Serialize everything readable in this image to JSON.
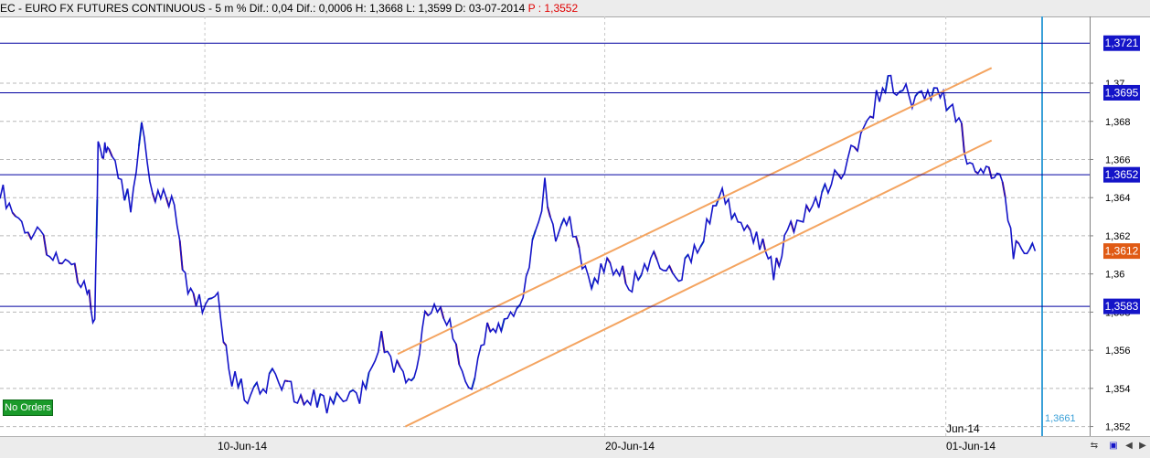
{
  "header": {
    "instrument": "EC - EURO FX FUTURES CONTINUOUS",
    "interval": "5 m",
    "dif_pct": "% Dif.: 0,04",
    "dif": "Dif.: 0,0006",
    "high": "H: 1,3668",
    "low": "L: 1,3599",
    "date": "D: 03-07-2014",
    "price": "P : 1,3552"
  },
  "badge": {
    "label": "No Orders",
    "color": "#1a9a2a"
  },
  "colors": {
    "price_line": "#1414c8",
    "up_tick": "#00a0a0",
    "down_tick": "#d01010",
    "channel": "#f4a460",
    "level": "#0000a0",
    "cursor": "#3aa0d8",
    "current_badge": "#e05a14"
  },
  "chart_data": {
    "type": "line",
    "ylim": [
      1.3515,
      1.3735
    ],
    "y_ticks": [
      "1,352",
      "1,354",
      "1,356",
      "1,358",
      "1,36",
      "1,362",
      "1,364",
      "1,366",
      "1,368",
      "1,37"
    ],
    "y_tick_values": [
      1.352,
      1.354,
      1.356,
      1.358,
      1.36,
      1.362,
      1.364,
      1.366,
      1.368,
      1.37
    ],
    "x_labels": [
      "10-Jun-14",
      "20-Jun-14",
      "01-Jun-14"
    ],
    "x_extra_label": "Jun-14",
    "horizontal_levels": [
      {
        "value": 1.3721,
        "label": "1,3721"
      },
      {
        "value": 1.3695,
        "label": "1,3695"
      },
      {
        "value": 1.3652,
        "label": "1,3652"
      },
      {
        "value": 1.3583,
        "label": "1,3583"
      }
    ],
    "current_value": {
      "value": 1.3612,
      "label": "1,3612"
    },
    "cursor_value": "1,3661",
    "channels": [
      {
        "from": [
          0.365,
          1.3558
        ],
        "to": [
          0.91,
          1.3708
        ]
      },
      {
        "from": [
          0.372,
          1.352
        ],
        "to": [
          0.91,
          1.367
        ]
      }
    ],
    "series": [
      {
        "x": [
          0,
          0.02,
          0.04,
          0.06,
          0.08,
          0.087,
          0.09,
          0.095,
          0.1,
          0.12,
          0.13,
          0.14,
          0.15,
          0.16,
          0.17,
          0.18,
          0.2,
          0.21,
          0.23,
          0.25,
          0.27,
          0.3,
          0.33,
          0.35,
          0.37,
          0.38,
          0.39,
          0.41,
          0.43,
          0.45,
          0.46,
          0.48,
          0.5,
          0.51,
          0.52,
          0.54,
          0.56,
          0.58,
          0.6,
          0.62,
          0.64,
          0.66,
          0.68,
          0.7,
          0.71,
          0.72,
          0.74,
          0.76,
          0.79,
          0.81,
          0.82,
          0.84,
          0.86,
          0.88,
          0.89,
          0.9,
          0.91,
          0.92,
          0.93,
          0.94,
          0.95
        ],
        "y": [
          1.3645,
          1.3625,
          1.3617,
          1.3605,
          1.3595,
          1.3572,
          1.3665,
          1.3665,
          1.3665,
          1.3635,
          1.368,
          1.364,
          1.364,
          1.3635,
          1.3598,
          1.3585,
          1.3585,
          1.3548,
          1.3535,
          1.3545,
          1.3538,
          1.3532,
          1.3535,
          1.3565,
          1.3545,
          1.3545,
          1.358,
          1.3578,
          1.354,
          1.3575,
          1.357,
          1.359,
          1.3645,
          1.3622,
          1.363,
          1.3595,
          1.3605,
          1.3595,
          1.3612,
          1.3598,
          1.3612,
          1.3642,
          1.3625,
          1.3615,
          1.36,
          1.3618,
          1.3633,
          1.3645,
          1.367,
          1.37,
          1.37,
          1.369,
          1.3695,
          1.368,
          1.3655,
          1.365,
          1.3655,
          1.3645,
          1.3612,
          1.3612,
          1.3612
        ]
      }
    ]
  }
}
